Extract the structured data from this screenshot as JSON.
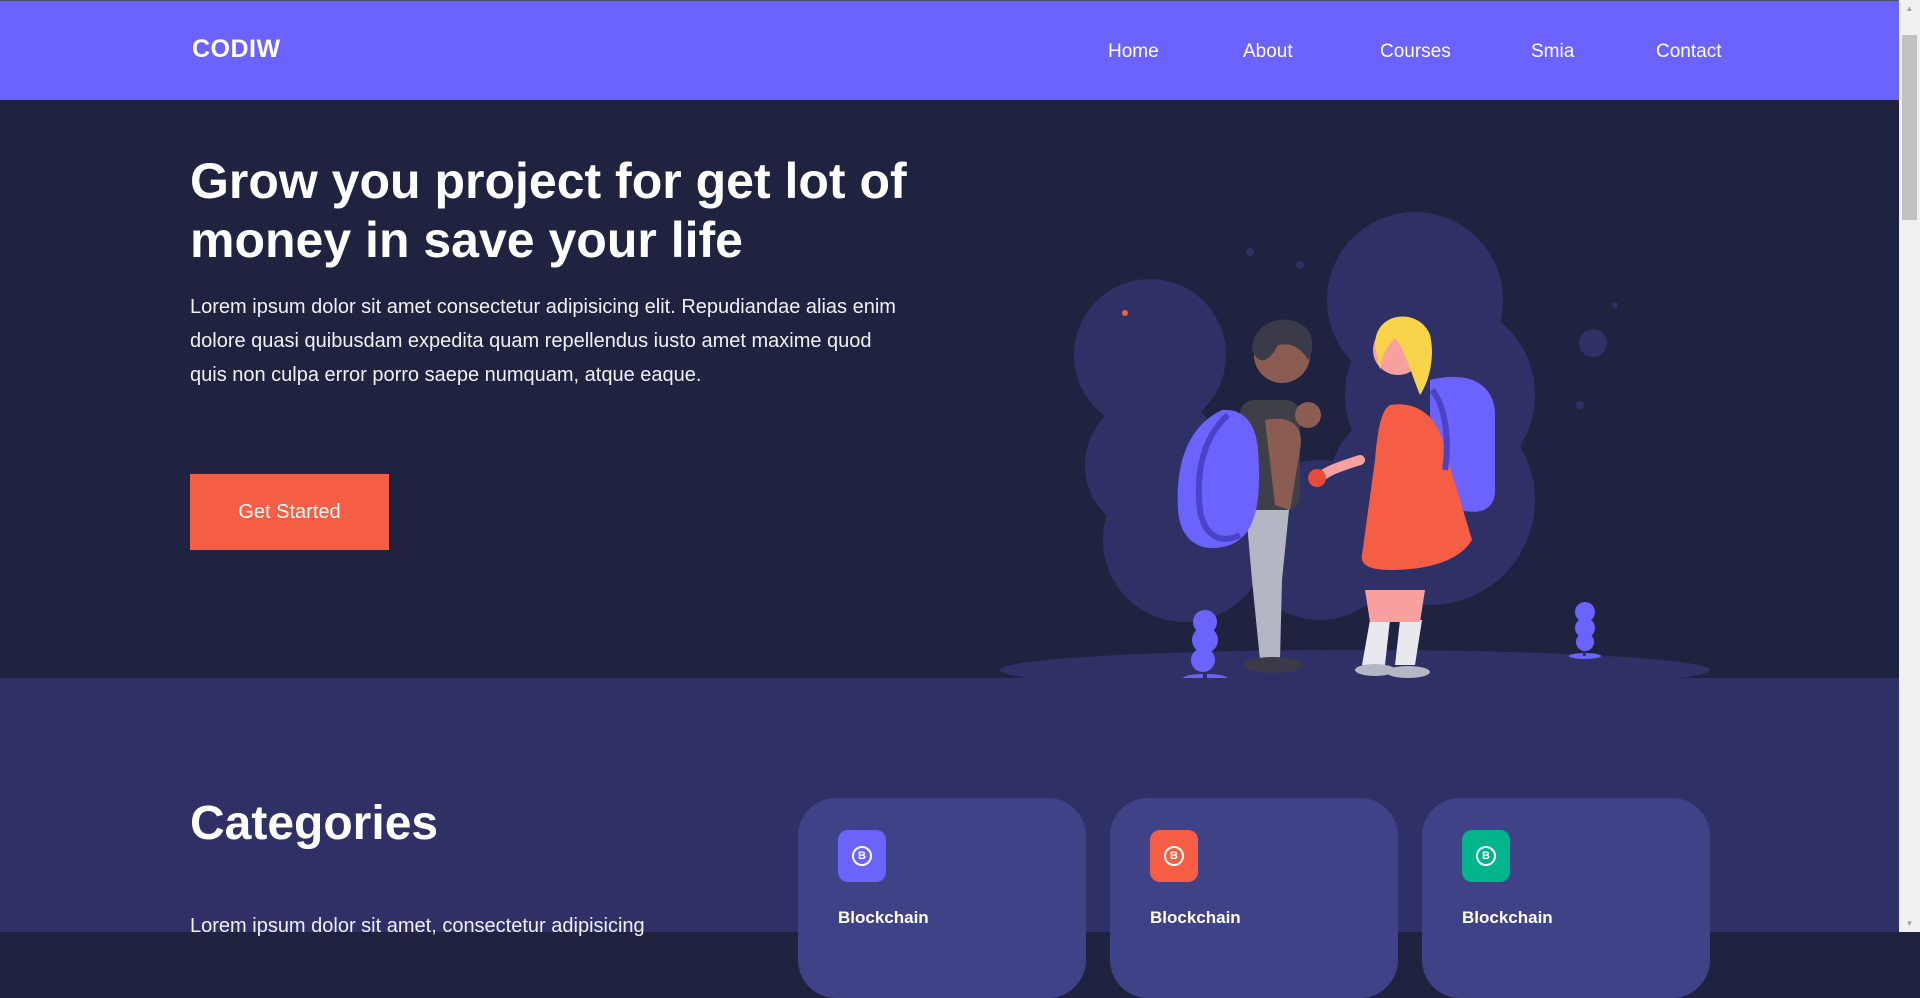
{
  "nav": {
    "brand": "CODIW",
    "links": [
      "Home",
      "About",
      "Courses",
      "Smia",
      "Contact"
    ]
  },
  "hero": {
    "title": "Grow you project for get lot of money in save your life",
    "text": "Lorem ipsum dolor sit amet consectetur adipisicing elit. Repudiandae alias enim dolore quasi quibusdam expedita quam repellendus iusto amet maxime quod quis non culpa error porro saepe numquam, atque eaque.",
    "cta_label": "Get Started"
  },
  "categories": {
    "title": "Categories",
    "text": "Lorem ipsum dolor sit amet, consectetur adipisicing",
    "cards": [
      {
        "title": "Blockchain",
        "icon": "bitcoin-icon",
        "color": "#6c63ff"
      },
      {
        "title": "Blockchain",
        "icon": "bitcoin-icon",
        "color": "#f55d44"
      },
      {
        "title": "Blockchain",
        "icon": "bitcoin-icon",
        "color": "#00b48b"
      }
    ]
  },
  "colors": {
    "primary": "#6c63ff",
    "accent": "#f55d44",
    "hero_bg": "#1f2340",
    "section_bg": "#2f3166",
    "card_bg": "#3f4286"
  }
}
